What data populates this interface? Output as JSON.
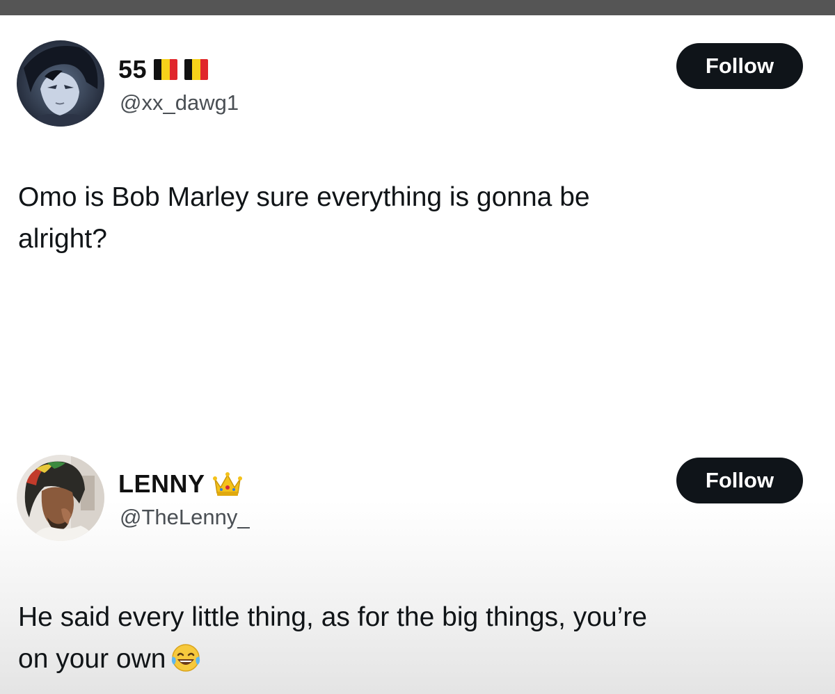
{
  "colors": {
    "follow_button_bg": "#0f1419",
    "follow_button_text": "#ffffff",
    "text_primary": "#101417",
    "text_secondary": "#4a4f54",
    "top_bar": "#555555"
  },
  "tweets": [
    {
      "display_name": "55",
      "name_badges": [
        "belgium-flag-icon",
        "belgium-flag-icon"
      ],
      "handle": "@xx_dawg1",
      "follow_label": "Follow",
      "avatar_icon": "anime-character-avatar",
      "text_line1": "Omo is Bob Marley sure everything is gonna be",
      "text_line2": "alright?"
    },
    {
      "display_name": "LENNY",
      "name_badges": [
        "crown-icon"
      ],
      "handle": "@TheLenny_",
      "follow_label": "Follow",
      "avatar_icon": "photo-avatar",
      "text_line1": "He said every little thing, as for the big things, you’re",
      "text_line2": "on your own",
      "trailing_emoji": "tears-of-joy-emoji-icon"
    }
  ]
}
